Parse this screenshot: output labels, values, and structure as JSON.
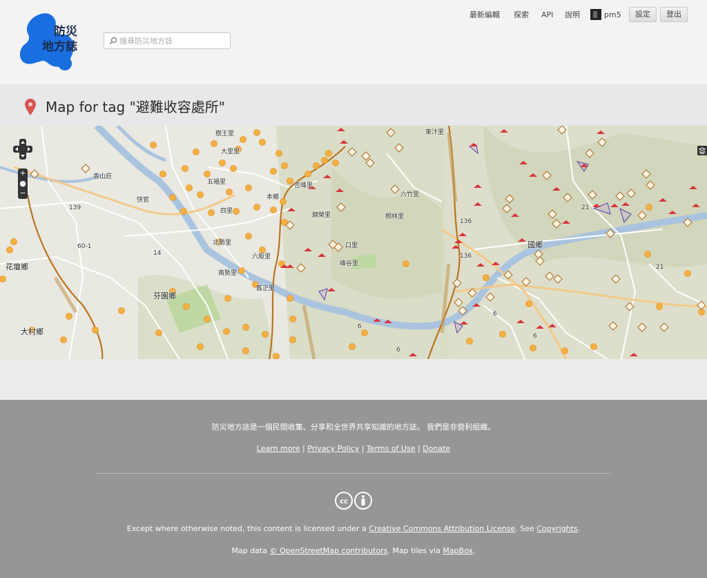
{
  "header": {
    "logo_text_line1": "防災",
    "logo_text_line2": "地方誌",
    "search_placeholder": "搜尋防災地方誌",
    "nav": {
      "recent": "最新編輯",
      "explore": "探索",
      "api": "API",
      "help": "說明",
      "username": "pm5"
    },
    "settings_button": "設定",
    "logout_button": "登出"
  },
  "page": {
    "title": "Map for tag \"避難收容處所\""
  },
  "map": {
    "labels": [
      {
        "id": "shuzhuli",
        "text": "樹王里"
      },
      {
        "id": "dadongli",
        "text": "大里里"
      },
      {
        "id": "xiangshanzhuang",
        "text": "香山莊"
      },
      {
        "id": "kuaiguan",
        "text": "快官"
      },
      {
        "id": "wufuli",
        "text": "五福里"
      },
      {
        "id": "jifengli",
        "text": "吉峰里"
      },
      {
        "id": "bennxiang",
        "text": "本鄉"
      },
      {
        "id": "daozhuli",
        "text": "六竹里"
      },
      {
        "id": "jingrongli",
        "text": "錦榮里"
      },
      {
        "id": "tonglinli",
        "text": "桐林里"
      },
      {
        "id": "sili",
        "text": "四里"
      },
      {
        "id": "beishili",
        "text": "北勢里"
      },
      {
        "id": "liujiaoli",
        "text": "六股里"
      },
      {
        "id": "nanshili",
        "text": "南勢里"
      },
      {
        "id": "fufengli",
        "text": "峰谷里"
      },
      {
        "id": "koukouli",
        "text": "口里"
      },
      {
        "id": "jiangzhengli",
        "text": "舊正里"
      },
      {
        "id": "huatanxiang",
        "text": "花壇鄉"
      },
      {
        "id": "fenyuanxiang",
        "text": "芬園鄉"
      },
      {
        "id": "datsunxiang",
        "text": "大村鄉"
      },
      {
        "id": "dongdaoli",
        "text": "東汴里"
      },
      {
        "id": "guoxingxiang",
        "text": "國鄉"
      },
      {
        "id": "road139",
        "text": "139"
      },
      {
        "id": "road14",
        "text": "14"
      },
      {
        "id": "road136a",
        "text": "136"
      },
      {
        "id": "road136b",
        "text": "136"
      },
      {
        "id": "road21a",
        "text": "21"
      },
      {
        "id": "road21b",
        "text": "21"
      },
      {
        "id": "road6a",
        "text": "6"
      },
      {
        "id": "road6b",
        "text": "6"
      },
      {
        "id": "road6c",
        "text": "6"
      },
      {
        "id": "road6d",
        "text": "6"
      },
      {
        "id": "road60",
        "text": "60-1"
      }
    ]
  },
  "footer": {
    "tagline": "防災地方誌是一個民間收集、分享和全世界共享知識的地方誌。 我們是非營利組織。",
    "links": {
      "learn_more": "Learn more",
      "privacy": "Privacy Policy",
      "terms": "Terms of Use",
      "donate": "Donate",
      "sep": "|"
    },
    "license_prefix": "Except where otherwise noted, this content is licensed under a ",
    "license_link": "Creative Commons Attribution License",
    "license_mid": ". See ",
    "copyrights_link": "Copyrights",
    "license_suffix": ".",
    "mapdata_prefix": "Map data ",
    "osm_link": "© OpenStreetMap contributors",
    "mapdata_mid": ". Map tiles via ",
    "mapbox_link": "MapBox",
    "mapdata_suffix": "."
  },
  "colors": {
    "footer_bg": "#969696",
    "logo_blue": "#1a6fe0",
    "marker_orange": "#f5b041",
    "marker_red": "#d9333a",
    "pin_red": "#d9534f",
    "route_orange": "#c97a2a"
  },
  "icons": {
    "search": "search-icon",
    "pin": "map-pin-icon",
    "pan": "pan-control-icon",
    "zoom_in": "zoom-in-icon",
    "zoom_out": "zoom-out-icon",
    "layers": "layers-icon",
    "cc": "creative-commons-icon",
    "by": "attribution-icon"
  }
}
